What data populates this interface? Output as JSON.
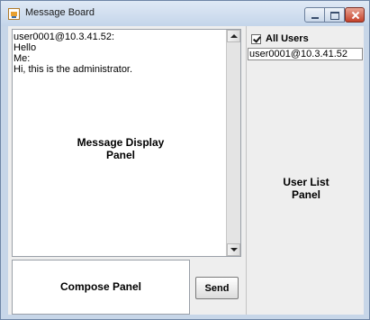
{
  "window": {
    "title": "Message Board",
    "icon": "java-cup-icon"
  },
  "message_panel": {
    "lines": [
      "user0001@10.3.41.52:",
      "Hello",
      "Me:",
      "Hi, this is the administrator."
    ],
    "label_line1": "Message Display",
    "label_line2": "Panel"
  },
  "compose": {
    "label": "Compose Panel",
    "send_label": "Send"
  },
  "user_panel": {
    "all_users_label": "All Users",
    "all_users_checked": true,
    "users": [
      "user0001@10.3.41.52"
    ],
    "label_line1": "User List",
    "label_line2": "Panel"
  }
}
